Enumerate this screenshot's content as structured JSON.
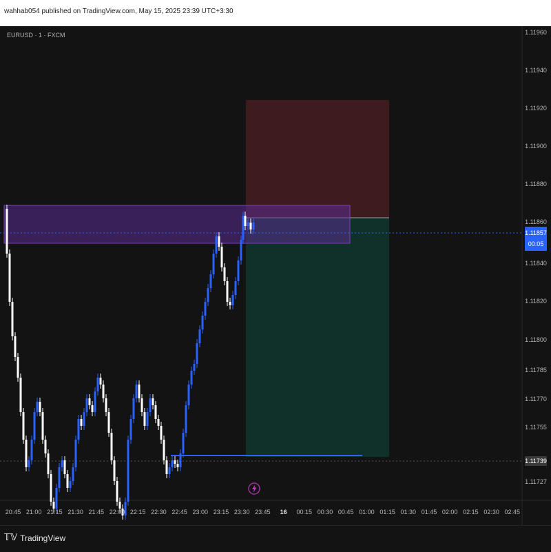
{
  "header": {
    "published_text": "wahhab054 published on TradingView.com, May 15, 2025 23:39 UTC+3:30"
  },
  "footer": {
    "brand": "TradingView",
    "logo_icon": "tradingview-logo-icon"
  },
  "chart_data": {
    "type": "candlestick",
    "symbol_label": "EURUSD · 1 · FXCM",
    "current_price": "1.11857",
    "countdown": "00:05",
    "marked_price": "1.11739",
    "price_ticks": [
      "1.11960",
      "1.11940",
      "1.11920",
      "1.11900",
      "1.11880",
      "1.11860",
      "1.11840",
      "1.11820",
      "1.11800",
      "1.11785",
      "1.11770",
      "1.11755",
      "1.11739",
      "1.11727"
    ],
    "time_ticks": [
      "20:45",
      "21:00",
      "21:15",
      "21:30",
      "21:45",
      "22:00",
      "22:15",
      "22:30",
      "22:45",
      "23:00",
      "23:15",
      "23:30",
      "23:45",
      "16",
      "00:15",
      "00:30",
      "00:45",
      "01:00",
      "01:15",
      "01:30",
      "01:45",
      "02:00",
      "02:15",
      "02:30",
      "02:45"
    ],
    "bold_time_tick": "16",
    "event_icon": "lightning-icon",
    "colors": {
      "up": "#2962ff",
      "down": "#ffffff",
      "accent": "#2962ff",
      "stop_zone": "#3d1b1f",
      "target_zone": "#0f3129",
      "supply_zone": "#5b2c91"
    },
    "note": "",
    "series": []
  }
}
